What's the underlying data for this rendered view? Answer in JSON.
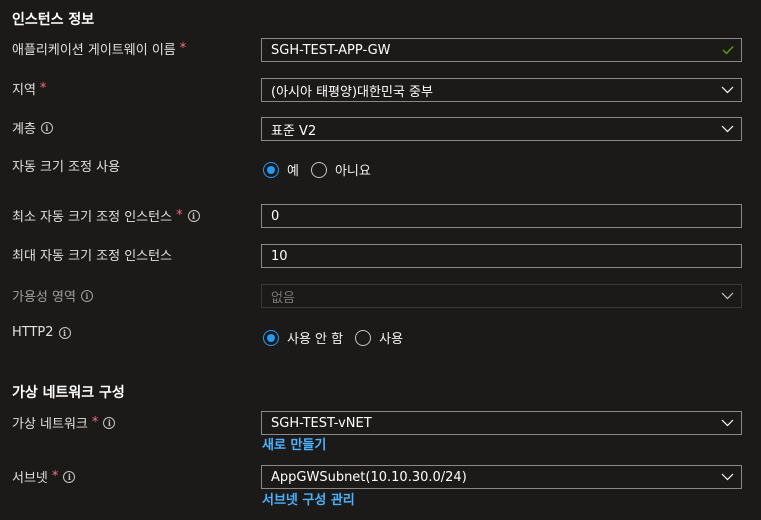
{
  "sections": {
    "instance": "인스턴스 정보",
    "vnet": "가상 네트워크 구성"
  },
  "fields": {
    "gateway_name": {
      "label": "애플리케이션 게이트웨이 이름",
      "required": "*",
      "value": "SGH-TEST-APP-GW"
    },
    "region": {
      "label": "지역",
      "required": "*",
      "value": "(아시아 태평양)대한민국 중부"
    },
    "tier": {
      "label": "계층",
      "value": "표준 V2"
    },
    "autoscale": {
      "label": "자동 크기 조정 사용",
      "option_yes": "예",
      "option_no": "아니요",
      "selected": "예"
    },
    "min_instances": {
      "label": "최소 자동 크기 조정 인스턴스",
      "required": "*",
      "value": "0"
    },
    "max_instances": {
      "label": "최대 자동 크기 조정 인스턴스",
      "value": "10"
    },
    "availability_zone": {
      "label": "가용성 영역",
      "value": "없음"
    },
    "http2": {
      "label": "HTTP2",
      "option_disabled": "사용 안 함",
      "option_enabled": "사용",
      "selected": "사용 안 함"
    },
    "virtual_network": {
      "label": "가상 네트워크",
      "required": "*",
      "value": "SGH-TEST-vNET",
      "link": "새로 만들기"
    },
    "subnet": {
      "label": "서브넷",
      "required": "*",
      "value": "AppGWSubnet(10.10.30.0/24)",
      "link": "서브넷 구성 관리"
    }
  },
  "info_glyph": "i",
  "colors": {
    "accent": "#2899f5",
    "link": "#4db2ff",
    "required": "#f1707b",
    "valid": "#57a300"
  },
  "icons": {
    "dropdown": "chevron-down-icon",
    "valid": "checkmark-icon",
    "info": "info-icon"
  }
}
